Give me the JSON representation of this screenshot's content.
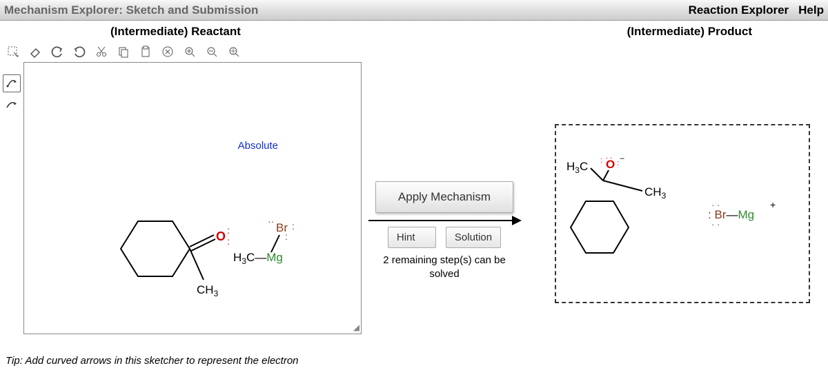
{
  "titlebar": {
    "title": "Mechanism Explorer: Sketch and Submission",
    "link_explorer": "Reaction Explorer",
    "link_help": "Help"
  },
  "sections": {
    "reactant": "(Intermediate) Reactant",
    "product": "(Intermediate) Product"
  },
  "toolbar_icons": [
    "select-marquee-icon",
    "eraser-icon",
    "undo-icon",
    "redo-icon",
    "cut-icon",
    "copy-icon",
    "paste-icon",
    "clear-icon",
    "zoom-in-icon",
    "zoom-out-icon",
    "zoom-fit-icon"
  ],
  "side_icons": [
    "flip-vertical-icon",
    "flip-horizontal-icon"
  ],
  "reactant": {
    "absolute": "Absolute",
    "label_o": "O",
    "label_br": "Br",
    "label_ch3": "CH",
    "label_h3c": "H",
    "label_mg": "C—Mg",
    "sub3": "3"
  },
  "center": {
    "apply": "Apply Mechanism",
    "hint": "Hint",
    "solution": "Solution",
    "status": "2 remaining step(s) can be solved"
  },
  "product": {
    "label_h3c": "H",
    "sub3a": "3",
    "label_c": "C",
    "label_o": "O",
    "label_ch3": "CH",
    "sub3b": "3",
    "label_brmg": "Br—Mg",
    "plus": "+"
  },
  "tip": "Tip: Add curved arrows in this sketcher to represent the electron",
  "colors": {
    "oxygen": "#d00000",
    "bromine": "#8a3a1a",
    "magnesium": "#2e8b2e"
  }
}
